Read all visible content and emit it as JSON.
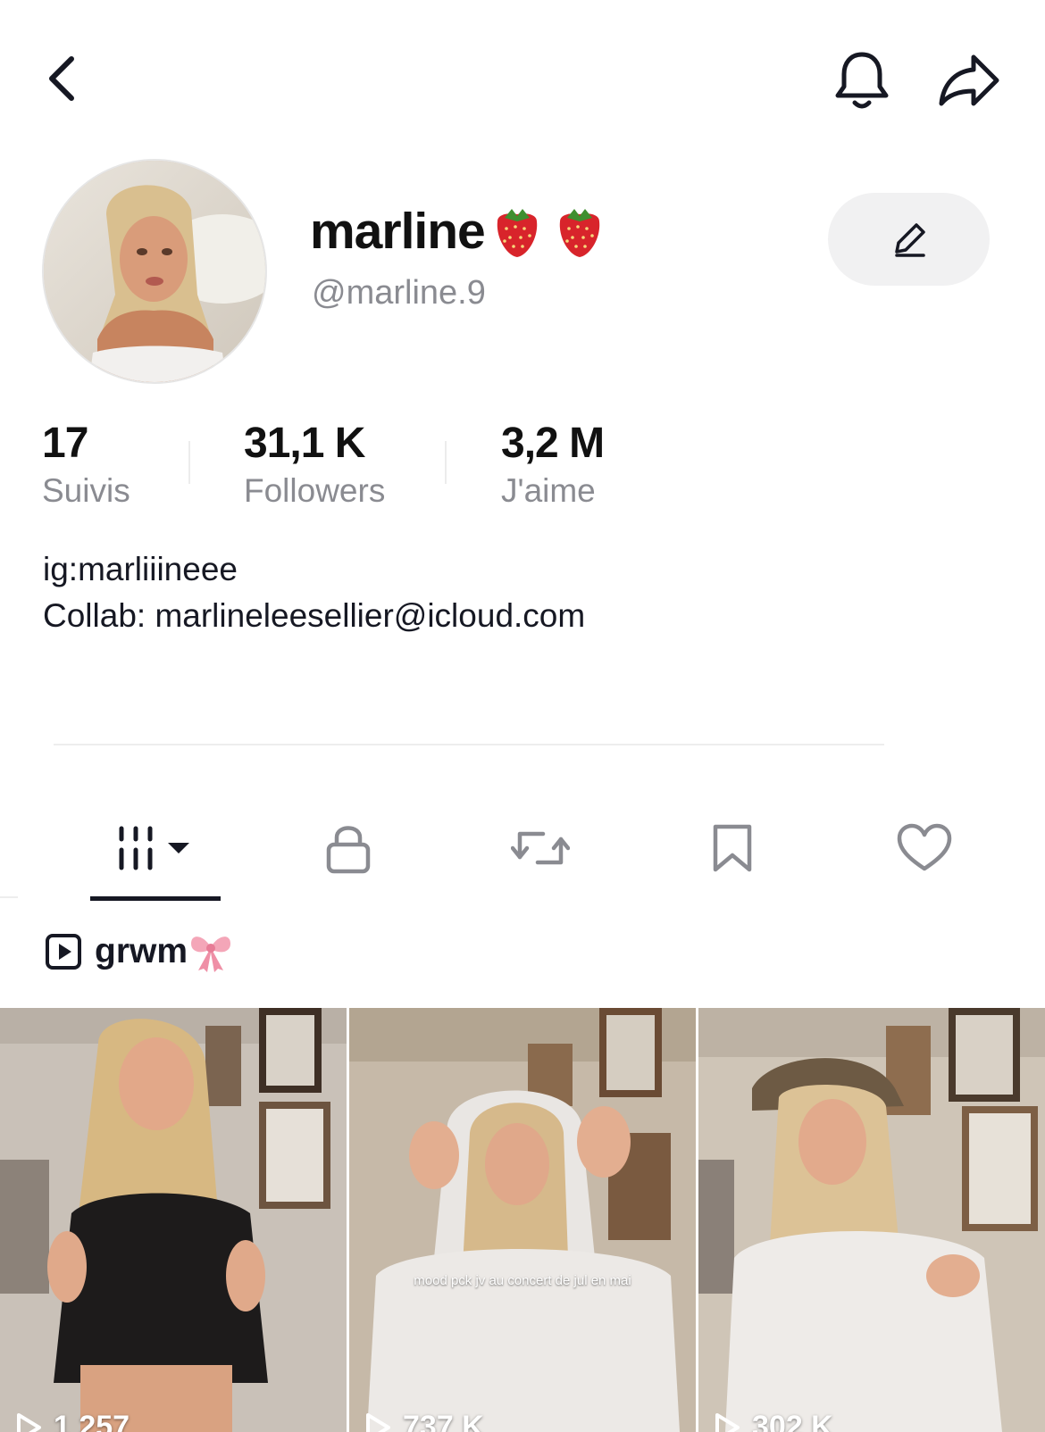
{
  "header": {
    "back_icon": "chevron-left-icon",
    "bell_icon": "bell-icon",
    "share_icon": "share-arrow-icon"
  },
  "profile": {
    "display_name": "marline",
    "name_emojis": [
      "strawberry",
      "strawberry"
    ],
    "handle": "@marline.9",
    "edit_icon": "pencil-icon"
  },
  "stats": [
    {
      "value": "17",
      "label": "Suivis"
    },
    {
      "value": "31,1 K",
      "label": "Followers"
    },
    {
      "value": "3,2 M",
      "label": "J'aime"
    }
  ],
  "bio": {
    "line1": "ig:marliiineee",
    "line2": "Collab: marlineleesellier@icloud.com"
  },
  "tabs": [
    {
      "name": "videos",
      "icon": "grid-dropdown-icon",
      "active": true
    },
    {
      "name": "private",
      "icon": "lock-icon",
      "active": false
    },
    {
      "name": "reposts",
      "icon": "repost-icon",
      "active": false
    },
    {
      "name": "favorites",
      "icon": "bookmark-icon",
      "active": false
    },
    {
      "name": "liked",
      "icon": "heart-icon",
      "active": false
    }
  ],
  "playlist": {
    "label": "grwm",
    "emoji": "ribbon"
  },
  "videos": [
    {
      "views": "1 257",
      "caption": ""
    },
    {
      "views": "737 K",
      "caption": "mood pck jv au concert de jul en mai"
    },
    {
      "views": "302 K",
      "caption": ""
    }
  ],
  "colors": {
    "text": "#161823",
    "secondary_text": "#8a8b91",
    "button_bg": "#f1f1f2",
    "strawberry": "#d8242b"
  }
}
